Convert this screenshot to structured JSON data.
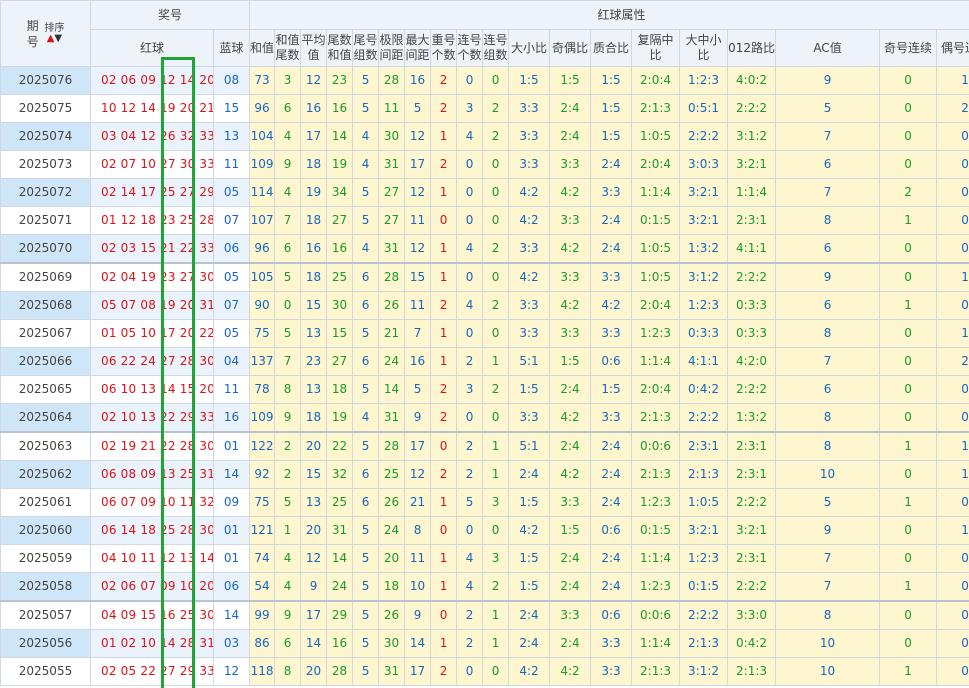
{
  "header": {
    "issue_label": "期号",
    "issue_l1": "期",
    "issue_l2": "号",
    "sort_label": "排序",
    "sort_arrows": "↑↓",
    "prize_label": "奖号",
    "red_label": "红球",
    "blue_label": "蓝球",
    "attr_label": "红球属性",
    "cols": [
      "和值",
      "和值尾数",
      "平均值",
      "尾数和值",
      "尾号组数",
      "极限间距",
      "最大间距",
      "重号个数",
      "连号个数",
      "连号组数",
      "大小比",
      "奇偶比",
      "质合比",
      "复隔中比",
      "大中小比",
      "012路比",
      "AC值",
      "奇号连续",
      "偶号连续"
    ]
  },
  "colors": {
    "red": "#d9131a",
    "blue": "#1767c2",
    "green": "#1b9a2a",
    "highlight": "#1fa535"
  },
  "rows": [
    {
      "issue": "2025076",
      "red": "02 06 09 12 14 20",
      "blue": "08",
      "v": [
        "73",
        "3",
        "12",
        "23",
        "5",
        "28",
        "16",
        "2",
        "0",
        "0",
        "1:5",
        "1:5",
        "1:5",
        "2:0:4",
        "1:2:3",
        "4:0:2",
        "9",
        "0",
        "1"
      ]
    },
    {
      "issue": "2025075",
      "red": "10 12 14 19 20 21",
      "blue": "15",
      "v": [
        "96",
        "6",
        "16",
        "16",
        "5",
        "11",
        "5",
        "2",
        "3",
        "2",
        "3:3",
        "2:4",
        "1:5",
        "2:1:3",
        "0:5:1",
        "2:2:2",
        "5",
        "0",
        "2"
      ]
    },
    {
      "issue": "2025074",
      "red": "03 04 12 26 32 33",
      "blue": "13",
      "v": [
        "104",
        "4",
        "17",
        "14",
        "4",
        "30",
        "12",
        "1",
        "4",
        "2",
        "3:3",
        "2:4",
        "1:5",
        "1:0:5",
        "2:2:2",
        "3:1:2",
        "7",
        "0",
        "0"
      ]
    },
    {
      "issue": "2025073",
      "red": "02 07 10 27 30 33",
      "blue": "11",
      "v": [
        "109",
        "9",
        "18",
        "19",
        "4",
        "31",
        "17",
        "2",
        "0",
        "0",
        "3:3",
        "3:3",
        "2:4",
        "2:0:4",
        "3:0:3",
        "3:2:1",
        "6",
        "0",
        "0"
      ]
    },
    {
      "issue": "2025072",
      "red": "02 14 17 25 27 29",
      "blue": "05",
      "v": [
        "114",
        "4",
        "19",
        "34",
        "5",
        "27",
        "12",
        "1",
        "0",
        "0",
        "4:2",
        "4:2",
        "3:3",
        "1:1:4",
        "3:2:1",
        "1:1:4",
        "7",
        "2",
        "0"
      ]
    },
    {
      "issue": "2025071",
      "red": "01 12 18 23 25 28",
      "blue": "07",
      "v": [
        "107",
        "7",
        "18",
        "27",
        "5",
        "27",
        "11",
        "0",
        "0",
        "0",
        "4:2",
        "3:3",
        "2:4",
        "0:1:5",
        "3:2:1",
        "2:3:1",
        "8",
        "1",
        "0"
      ]
    },
    {
      "issue": "2025070",
      "red": "02 03 15 21 22 33",
      "blue": "06",
      "v": [
        "96",
        "6",
        "16",
        "16",
        "4",
        "31",
        "12",
        "1",
        "4",
        "2",
        "3:3",
        "4:2",
        "2:4",
        "1:0:5",
        "1:3:2",
        "4:1:1",
        "6",
        "0",
        "0"
      ]
    },
    {
      "issue": "2025069",
      "red": "02 04 19 23 27 30",
      "blue": "05",
      "v": [
        "105",
        "5",
        "18",
        "25",
        "6",
        "28",
        "15",
        "1",
        "0",
        "0",
        "4:2",
        "3:3",
        "3:3",
        "1:0:5",
        "3:1:2",
        "2:2:2",
        "9",
        "0",
        "1"
      ]
    },
    {
      "issue": "2025068",
      "red": "05 07 08 19 20 31",
      "blue": "07",
      "v": [
        "90",
        "0",
        "15",
        "30",
        "6",
        "26",
        "11",
        "2",
        "4",
        "2",
        "3:3",
        "4:2",
        "4:2",
        "2:0:4",
        "1:2:3",
        "0:3:3",
        "6",
        "1",
        "0"
      ]
    },
    {
      "issue": "2025067",
      "red": "01 05 10 17 20 22",
      "blue": "05",
      "v": [
        "75",
        "5",
        "13",
        "15",
        "5",
        "21",
        "7",
        "1",
        "0",
        "0",
        "3:3",
        "3:3",
        "3:3",
        "1:2:3",
        "0:3:3",
        "0:3:3",
        "8",
        "0",
        "1"
      ]
    },
    {
      "issue": "2025066",
      "red": "06 22 24 27 28 30",
      "blue": "04",
      "v": [
        "137",
        "7",
        "23",
        "27",
        "6",
        "24",
        "16",
        "1",
        "2",
        "1",
        "5:1",
        "1:5",
        "0:6",
        "1:1:4",
        "4:1:1",
        "4:2:0",
        "7",
        "0",
        "2"
      ]
    },
    {
      "issue": "2025065",
      "red": "06 10 13 14 15 20",
      "blue": "11",
      "v": [
        "78",
        "8",
        "13",
        "18",
        "5",
        "14",
        "5",
        "2",
        "3",
        "2",
        "1:5",
        "2:4",
        "1:5",
        "2:0:4",
        "0:4:2",
        "2:2:2",
        "6",
        "0",
        "0"
      ]
    },
    {
      "issue": "2025064",
      "red": "02 10 13 22 29 33",
      "blue": "16",
      "v": [
        "109",
        "9",
        "18",
        "19",
        "4",
        "31",
        "9",
        "2",
        "0",
        "0",
        "3:3",
        "4:2",
        "3:3",
        "2:1:3",
        "2:2:2",
        "1:3:2",
        "8",
        "0",
        "0"
      ]
    },
    {
      "issue": "2025063",
      "red": "02 19 21 22 28 30",
      "blue": "01",
      "v": [
        "122",
        "2",
        "20",
        "22",
        "5",
        "28",
        "17",
        "0",
        "2",
        "1",
        "5:1",
        "2:4",
        "2:4",
        "0:0:6",
        "2:3:1",
        "2:3:1",
        "8",
        "1",
        "1"
      ]
    },
    {
      "issue": "2025062",
      "red": "06 08 09 13 25 31",
      "blue": "14",
      "v": [
        "92",
        "2",
        "15",
        "32",
        "6",
        "25",
        "12",
        "2",
        "2",
        "1",
        "2:4",
        "4:2",
        "2:4",
        "2:1:3",
        "2:1:3",
        "2:3:1",
        "10",
        "0",
        "1"
      ]
    },
    {
      "issue": "2025061",
      "red": "06 07 09 10 11 32",
      "blue": "09",
      "v": [
        "75",
        "5",
        "13",
        "25",
        "6",
        "26",
        "21",
        "1",
        "5",
        "3",
        "1:5",
        "3:3",
        "2:4",
        "1:2:3",
        "1:0:5",
        "2:2:2",
        "5",
        "1",
        "0"
      ]
    },
    {
      "issue": "2025060",
      "red": "06 14 18 25 28 30",
      "blue": "01",
      "v": [
        "121",
        "1",
        "20",
        "31",
        "5",
        "24",
        "8",
        "0",
        "0",
        "0",
        "4:2",
        "1:5",
        "0:6",
        "0:1:5",
        "3:2:1",
        "3:2:1",
        "9",
        "0",
        "1"
      ]
    },
    {
      "issue": "2025059",
      "red": "04 10 11 12 13 14",
      "blue": "01",
      "v": [
        "74",
        "4",
        "12",
        "14",
        "5",
        "20",
        "11",
        "1",
        "4",
        "3",
        "1:5",
        "2:4",
        "2:4",
        "1:1:4",
        "1:2:3",
        "2:3:1",
        "7",
        "0",
        "0"
      ]
    },
    {
      "issue": "2025058",
      "red": "02 06 07 09 10 20",
      "blue": "06",
      "v": [
        "54",
        "4",
        "9",
        "24",
        "5",
        "18",
        "10",
        "1",
        "4",
        "2",
        "1:5",
        "2:4",
        "2:4",
        "1:2:3",
        "0:1:5",
        "2:2:2",
        "7",
        "1",
        "0"
      ]
    },
    {
      "issue": "2025057",
      "red": "04 09 15 16 25 30",
      "blue": "14",
      "v": [
        "99",
        "9",
        "17",
        "29",
        "5",
        "26",
        "9",
        "0",
        "2",
        "1",
        "2:4",
        "3:3",
        "0:6",
        "0:0:6",
        "2:2:2",
        "3:3:0",
        "8",
        "0",
        "0"
      ]
    },
    {
      "issue": "2025056",
      "red": "01 02 10 14 28 31",
      "blue": "03",
      "v": [
        "86",
        "6",
        "14",
        "16",
        "5",
        "30",
        "14",
        "1",
        "2",
        "1",
        "2:4",
        "2:4",
        "3:3",
        "1:1:4",
        "2:1:3",
        "0:4:2",
        "10",
        "0",
        "0"
      ]
    },
    {
      "issue": "2025055",
      "red": "02 05 22 27 29 33",
      "blue": "12",
      "v": [
        "118",
        "8",
        "20",
        "28",
        "5",
        "31",
        "17",
        "2",
        "0",
        "0",
        "4:2",
        "4:2",
        "3:3",
        "2:1:3",
        "3:1:2",
        "2:1:3",
        "10",
        "1",
        "0"
      ]
    }
  ]
}
